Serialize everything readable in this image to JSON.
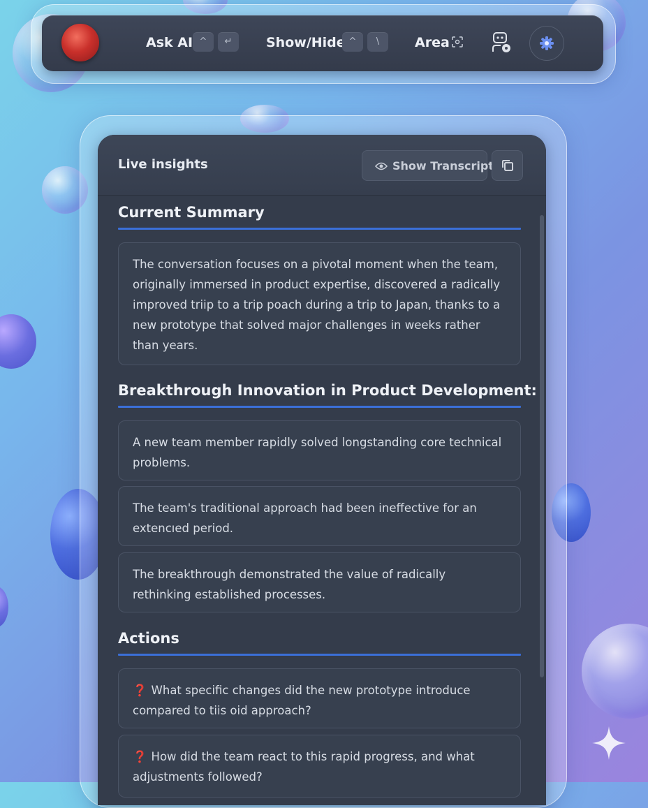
{
  "colors": {
    "accent": "#3b6fd8",
    "panel_bg": "#343c4b",
    "toolbar_bg": "#3a4253",
    "question_mark": "#e0443e"
  },
  "toolbar": {
    "ask_ai_label": "Ask AI",
    "ask_ai_keys": [
      "^",
      "↵"
    ],
    "show_hide_label": "Show/Hide",
    "show_hide_keys": [
      "^",
      "\\"
    ],
    "area_label": "Area",
    "icons": [
      "avatar",
      "area-capture-icon",
      "assistant-icon",
      "gear-icon"
    ]
  },
  "panel": {
    "title": "Live insights",
    "show_transcript_label": "Show Transcript",
    "icons": [
      "eye-icon",
      "copy-icon"
    ]
  },
  "summary": {
    "heading": "Current Summary",
    "text": "The conversation focuses on a pivotal moment when the team, originally immersed in product expertise, discovered a radically improved triip to a trip poach during a trip to Japan, thanks to a new prototype that solved major challenges in weeks rather than years."
  },
  "breakthrough": {
    "heading": "Breakthrough Innovation in Product Development:",
    "items": [
      "A new team member rapidly solved longstanding core technical problems.",
      "The team's traditional approach had been ineffective for an extencıed period.",
      "The breakthrough demonstrated the value of radically rethinking established processes."
    ]
  },
  "actions": {
    "heading": "Actions",
    "question_icon": "❓",
    "items": [
      "What specific changes did the new prototype introduce compared to tiis oid approach?",
      "How did the team react to this rapid progress, and what adjustments followed?"
    ]
  }
}
